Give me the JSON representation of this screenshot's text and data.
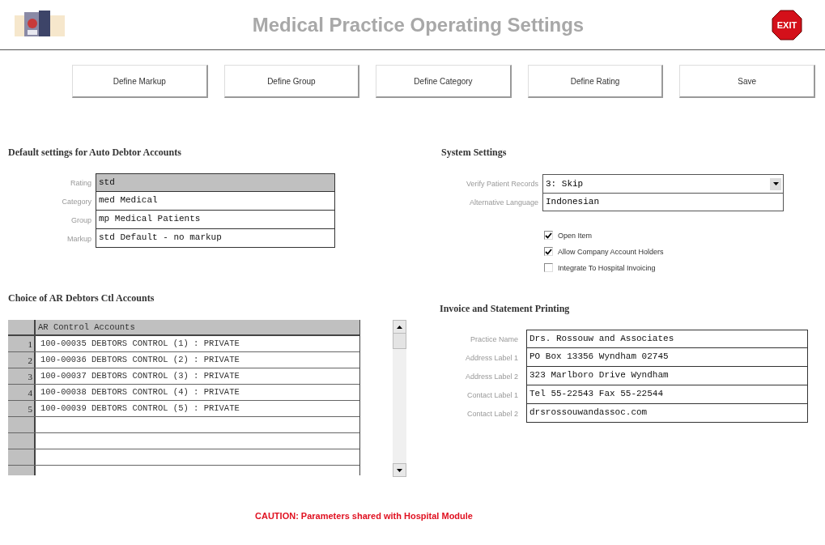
{
  "header": {
    "title": "Medical Practice Operating Settings",
    "exit_label": "EXIT"
  },
  "buttons": [
    "Define Markup",
    "Define Group",
    "Define Category",
    "Define Rating",
    "Save"
  ],
  "default_settings": {
    "title": "Default settings for Auto Debtor Accounts",
    "fields": [
      {
        "label": "Rating",
        "value": "std",
        "selected": true
      },
      {
        "label": "Category",
        "value": "med Medical",
        "selected": false
      },
      {
        "label": "Group",
        "value": "mp Medical Patients",
        "selected": false
      },
      {
        "label": "Markup",
        "value": "std Default - no markup",
        "selected": false
      }
    ]
  },
  "ar_accounts": {
    "title": "Choice of AR Debtors Ctl Accounts",
    "column": "AR Control Accounts",
    "rows": [
      {
        "number": "1",
        "account": "100-00035 DEBTORS CONTROL (1) : PRIVATE"
      },
      {
        "number": "2",
        "account": "100-00036 DEBTORS CONTROL (2) : PRIVATE"
      },
      {
        "number": "3",
        "account": "100-00037 DEBTORS CONTROL (3) : PRIVATE"
      },
      {
        "number": "4",
        "account": "100-00038 DEBTORS CONTROL (4) : PRIVATE"
      },
      {
        "number": "5",
        "account": "100-00039 DEBTORS CONTROL (5) : PRIVATE"
      }
    ]
  },
  "system_settings": {
    "title": "System Settings",
    "verify": {
      "label": "Verify Patient Records",
      "value": "3: Skip"
    },
    "language": {
      "label": "Alternative Language",
      "value": "Indonesian"
    },
    "options": [
      {
        "label": "Open Item",
        "checked": true
      },
      {
        "label": "Allow Company Account Holders",
        "checked": true
      },
      {
        "label": "Integrate To Hospital Invoicing",
        "checked": false
      }
    ]
  },
  "invoice_printing": {
    "title": "Invoice and Statement Printing",
    "fields": [
      {
        "label": "Practice Name",
        "value": "Drs. Rossouw and Associates"
      },
      {
        "label": "Address Label 1",
        "value": "PO Box 13356 Wyndham 02745"
      },
      {
        "label": "Address Label 2",
        "value": "323 Marlboro Drive Wyndham"
      },
      {
        "label": "Contact Label 1",
        "value": "Tel 55-22543  Fax 55-22544"
      },
      {
        "label": "Contact Label 2",
        "value": "drsrossouwandassoc.com"
      }
    ]
  },
  "caution": "CAUTION: Parameters shared with Hospital Module"
}
